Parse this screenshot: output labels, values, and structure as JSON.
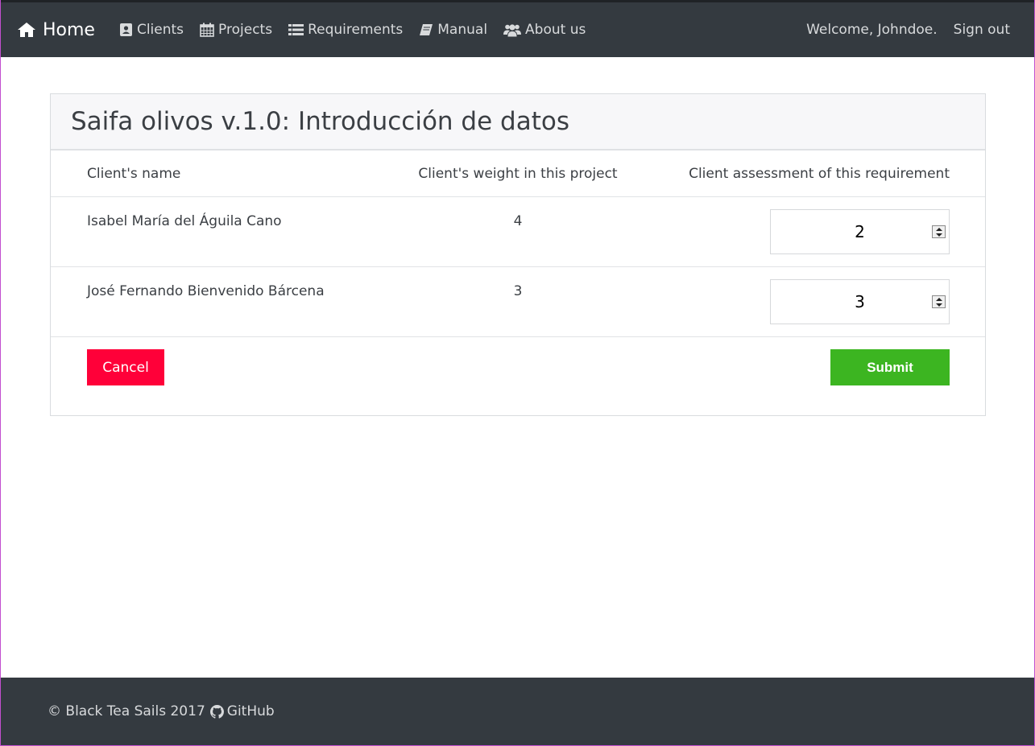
{
  "nav": {
    "brand": "Home",
    "items": [
      {
        "label": "Clients",
        "icon": "address-card-icon"
      },
      {
        "label": "Projects",
        "icon": "calendar-icon"
      },
      {
        "label": "Requirements",
        "icon": "list-icon"
      },
      {
        "label": "Manual",
        "icon": "book-icon"
      },
      {
        "label": "About us",
        "icon": "users-icon"
      }
    ],
    "welcome": "Welcome, Johndoe.",
    "signout": "Sign out"
  },
  "card": {
    "title": "Saifa olivos v.1.0: Introducción de datos",
    "headers": {
      "name": "Client's name",
      "weight": "Client's weight in this project",
      "assessment": "Client assessment of this requirement"
    },
    "rows": [
      {
        "name": "Isabel María del Águila Cano",
        "weight": "4",
        "assessment": "2"
      },
      {
        "name": "José Fernando Bienvenido Bárcena",
        "weight": "3",
        "assessment": "3"
      }
    ],
    "cancel_label": "Cancel",
    "submit_label": "Submit"
  },
  "footer": {
    "copyright": "© Black Tea Sails 2017",
    "github": "GitHub"
  },
  "colors": {
    "navbar": "#343a40",
    "cancel": "#ff0039",
    "submit": "#3cb521"
  }
}
